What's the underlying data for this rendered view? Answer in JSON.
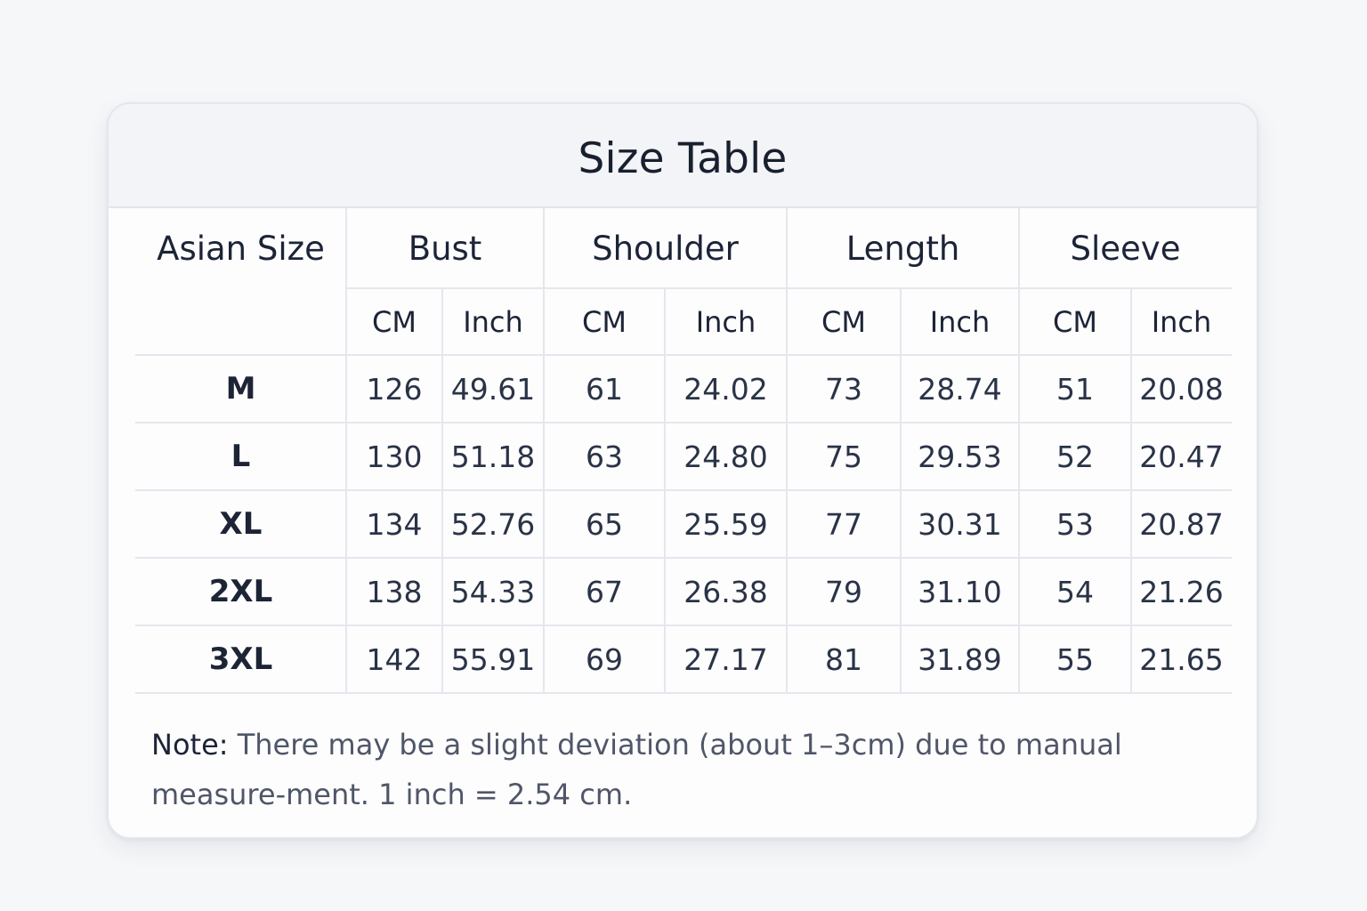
{
  "title": "Size Table",
  "columns": {
    "size_header": "Asian Size",
    "groups": [
      "Bust",
      "Shoulder",
      "Length",
      "Sleeve"
    ],
    "units": [
      "CM",
      "Inch",
      "CM",
      "Inch",
      "CM",
      "Inch",
      "CM",
      "Inch"
    ]
  },
  "rows": [
    {
      "size": "M",
      "values": [
        "126",
        "49.61",
        "61",
        "24.02",
        "73",
        "28.74",
        "51",
        "20.08"
      ]
    },
    {
      "size": "L",
      "values": [
        "130",
        "51.18",
        "63",
        "24.80",
        "75",
        "29.53",
        "52",
        "20.47"
      ]
    },
    {
      "size": "XL",
      "values": [
        "134",
        "52.76",
        "65",
        "25.59",
        "77",
        "30.31",
        "53",
        "20.87"
      ]
    },
    {
      "size": "2XL",
      "values": [
        "138",
        "54.33",
        "67",
        "26.38",
        "79",
        "31.10",
        "54",
        "21.26"
      ]
    },
    {
      "size": "3XL",
      "values": [
        "142",
        "55.91",
        "69",
        "27.17",
        "81",
        "31.89",
        "55",
        "21.65"
      ]
    }
  ],
  "note": {
    "label": "Note:",
    "text": " There may be a slight deviation (about 1–3cm) due to manual measure-ment. 1 inch = 2.54 cm."
  }
}
